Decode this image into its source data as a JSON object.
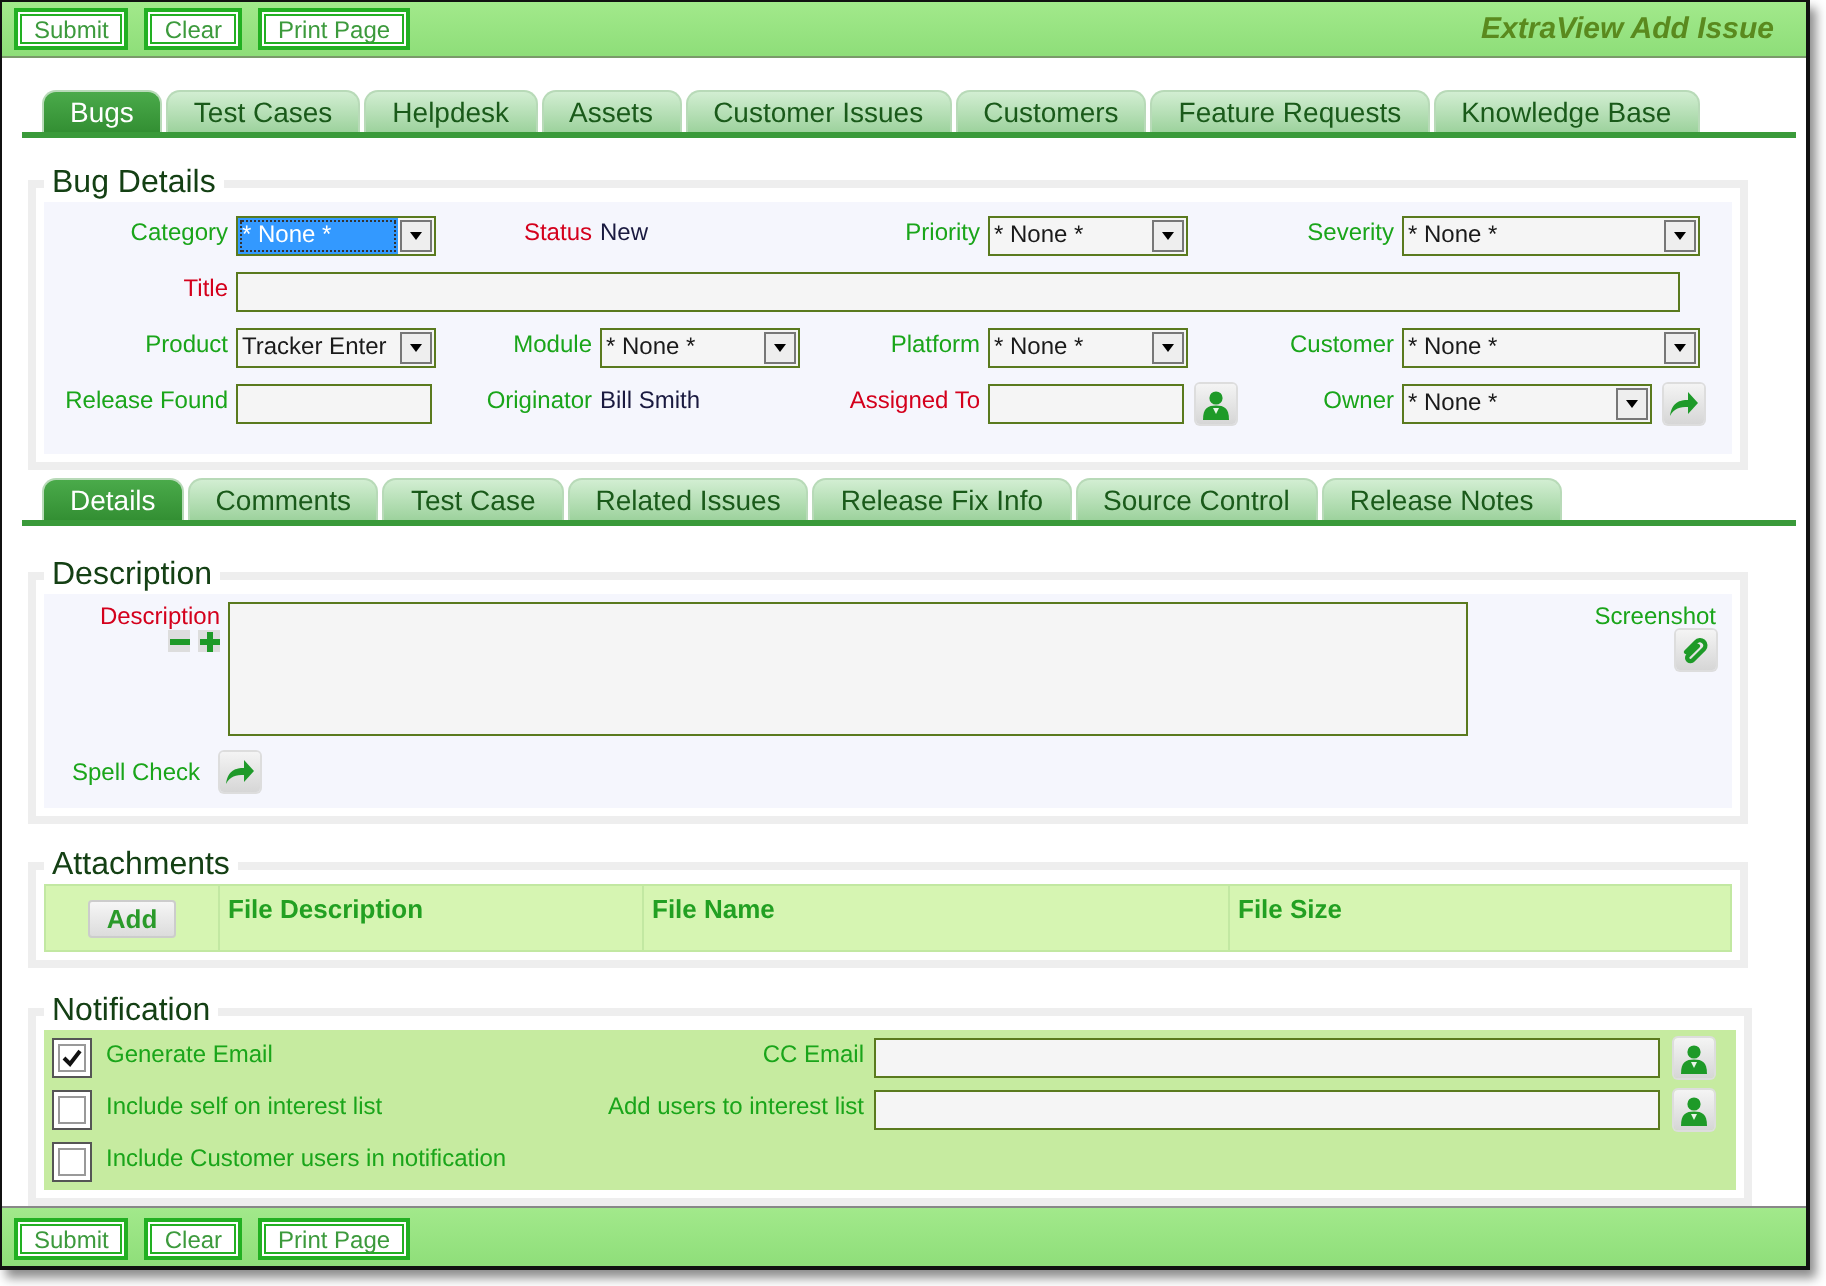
{
  "top_toolbar": {
    "buttons": [
      "Submit",
      "Clear",
      "Print Page"
    ],
    "title": "ExtraView Add Issue"
  },
  "tabs": [
    {
      "label": "Bugs",
      "selected": true
    },
    {
      "label": "Test Cases",
      "selected": false
    },
    {
      "label": "Helpdesk",
      "selected": false
    },
    {
      "label": "Assets",
      "selected": false
    },
    {
      "label": "Customer Issues",
      "selected": false
    },
    {
      "label": "Customers",
      "selected": false
    },
    {
      "label": "Feature Requests",
      "selected": false
    },
    {
      "label": "Knowledge Base",
      "selected": false
    }
  ],
  "bug_details": {
    "heading": "Bug Details",
    "fields": [
      {
        "label": "Category",
        "required": false,
        "kind": "select",
        "value": "* None *",
        "focused": true
      },
      {
        "label": "Status",
        "required": true,
        "kind": "static",
        "value": "New"
      },
      {
        "label": "Priority",
        "required": false,
        "kind": "select",
        "value": "* None *",
        "focused": false
      },
      {
        "label": "Severity",
        "required": false,
        "kind": "select",
        "value": "* None *",
        "focused": false
      },
      {
        "label": "Title",
        "required": true,
        "kind": "wide_text"
      },
      {
        "label": "Product",
        "required": false,
        "kind": "select",
        "value": "Tracker Enter",
        "focused": false
      },
      {
        "label": "Module",
        "required": false,
        "kind": "select",
        "value": "* None *",
        "focused": false
      },
      {
        "label": "Platform",
        "required": false,
        "kind": "select",
        "value": "* None *",
        "focused": false
      },
      {
        "label": "Customer",
        "required": false,
        "kind": "select",
        "value": "* None *",
        "focused": false
      },
      {
        "label": "Release Found",
        "required": false,
        "kind": "text"
      },
      {
        "label": "Originator",
        "required": false,
        "kind": "static",
        "value": "Bill Smith"
      },
      {
        "label": "Assigned To",
        "required": true,
        "kind": "user_picker"
      },
      {
        "label": "Owner",
        "required": false,
        "kind": "select_action",
        "value": "* None *",
        "focused": false
      }
    ]
  },
  "detail_tabs": [
    {
      "label": "Details",
      "selected": true
    },
    {
      "label": "Comments",
      "selected": false
    },
    {
      "label": "Test Case",
      "selected": false
    },
    {
      "label": "Related Issues",
      "selected": false
    },
    {
      "label": "Release Fix Info",
      "selected": false
    },
    {
      "label": "Source Control",
      "selected": false
    },
    {
      "label": "Release Notes",
      "selected": false
    }
  ],
  "description": {
    "heading": "Description",
    "label": "Description",
    "required": true,
    "side_label": "Screenshot",
    "spell_check": "Spell Check"
  },
  "attachments": {
    "heading": "Attachments",
    "add_button": "Add",
    "columns": [
      "File Description",
      "File Name",
      "File Size"
    ]
  },
  "notification": {
    "heading": "Notification",
    "options": [
      {
        "label": "Generate Email",
        "checked": true
      },
      {
        "label": "Include self on interest list",
        "checked": false
      },
      {
        "label": "Include Customer users in notification",
        "checked": false
      }
    ],
    "fields": [
      {
        "label": "CC Email"
      },
      {
        "label": "Add users to interest list"
      }
    ]
  },
  "bottom_toolbar": {
    "buttons": [
      "Submit",
      "Clear",
      "Print Page"
    ]
  }
}
